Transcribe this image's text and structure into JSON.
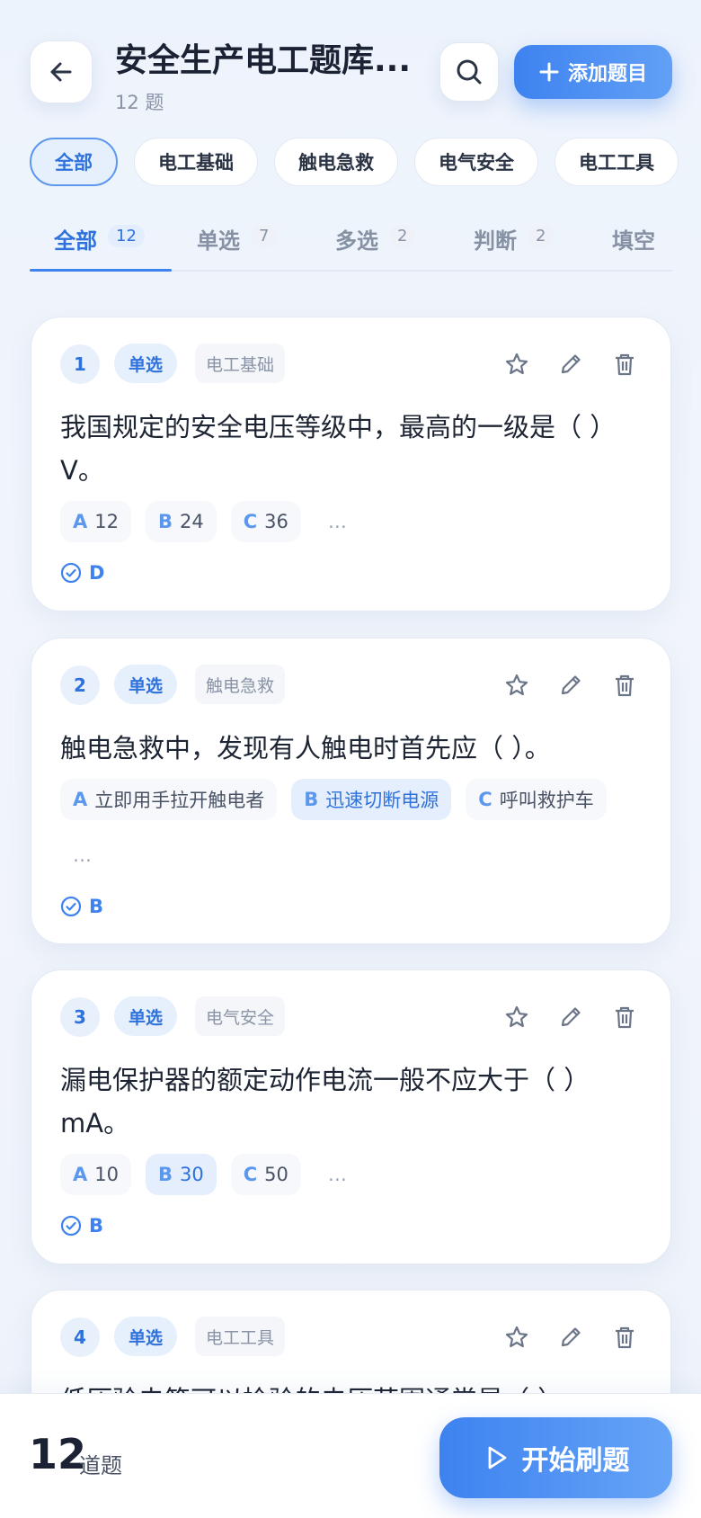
{
  "header": {
    "title": "安全生产电工题库...",
    "subtitle": "12 题",
    "add_label": "添加题目"
  },
  "categories": [
    "全部",
    "电工基础",
    "触电急救",
    "电气安全",
    "电工工具"
  ],
  "tabs": [
    {
      "label": "全部",
      "count": "12"
    },
    {
      "label": "单选",
      "count": "7"
    },
    {
      "label": "多选",
      "count": "2"
    },
    {
      "label": "判断",
      "count": "2"
    },
    {
      "label": "填空",
      "count": ""
    }
  ],
  "questions": [
    {
      "num": "1",
      "type": "单选",
      "category": "电工基础",
      "text": "我国规定的安全电压等级中，最高的一级是（ ）V。",
      "options": [
        {
          "letter": "A",
          "text": "12"
        },
        {
          "letter": "B",
          "text": "24"
        },
        {
          "letter": "C",
          "text": "36"
        }
      ],
      "more": "…",
      "answer": "D"
    },
    {
      "num": "2",
      "type": "单选",
      "category": "触电急救",
      "text": "触电急救中，发现有人触电时首先应（ ）。",
      "options": [
        {
          "letter": "A",
          "text": "立即用手拉开触电者"
        },
        {
          "letter": "B",
          "text": "迅速切断电源"
        },
        {
          "letter": "C",
          "text": "呼叫救护车"
        }
      ],
      "more": "…",
      "answer": "B"
    },
    {
      "num": "3",
      "type": "单选",
      "category": "电气安全",
      "text": "漏电保护器的额定动作电流一般不应大于（ ）mA。",
      "options": [
        {
          "letter": "A",
          "text": "10"
        },
        {
          "letter": "B",
          "text": "30"
        },
        {
          "letter": "C",
          "text": "50"
        }
      ],
      "more": "…",
      "answer": "B"
    },
    {
      "num": "4",
      "type": "单选",
      "category": "电工工具",
      "text": "低压验电笔可以检验的电压范围通常是（ ）"
    }
  ],
  "footer": {
    "total": "12",
    "total_label": "道题",
    "start_label": "开始刷题"
  },
  "colors": {
    "accent": "#3d82f0",
    "accent_light": "#e6effc",
    "text_primary": "#1d2433",
    "text_muted": "#8a94a6"
  },
  "icons": [
    "back-arrow-icon",
    "search-icon",
    "plus-icon",
    "star-icon",
    "pencil-icon",
    "trash-icon",
    "check-circle-icon",
    "play-icon"
  ]
}
